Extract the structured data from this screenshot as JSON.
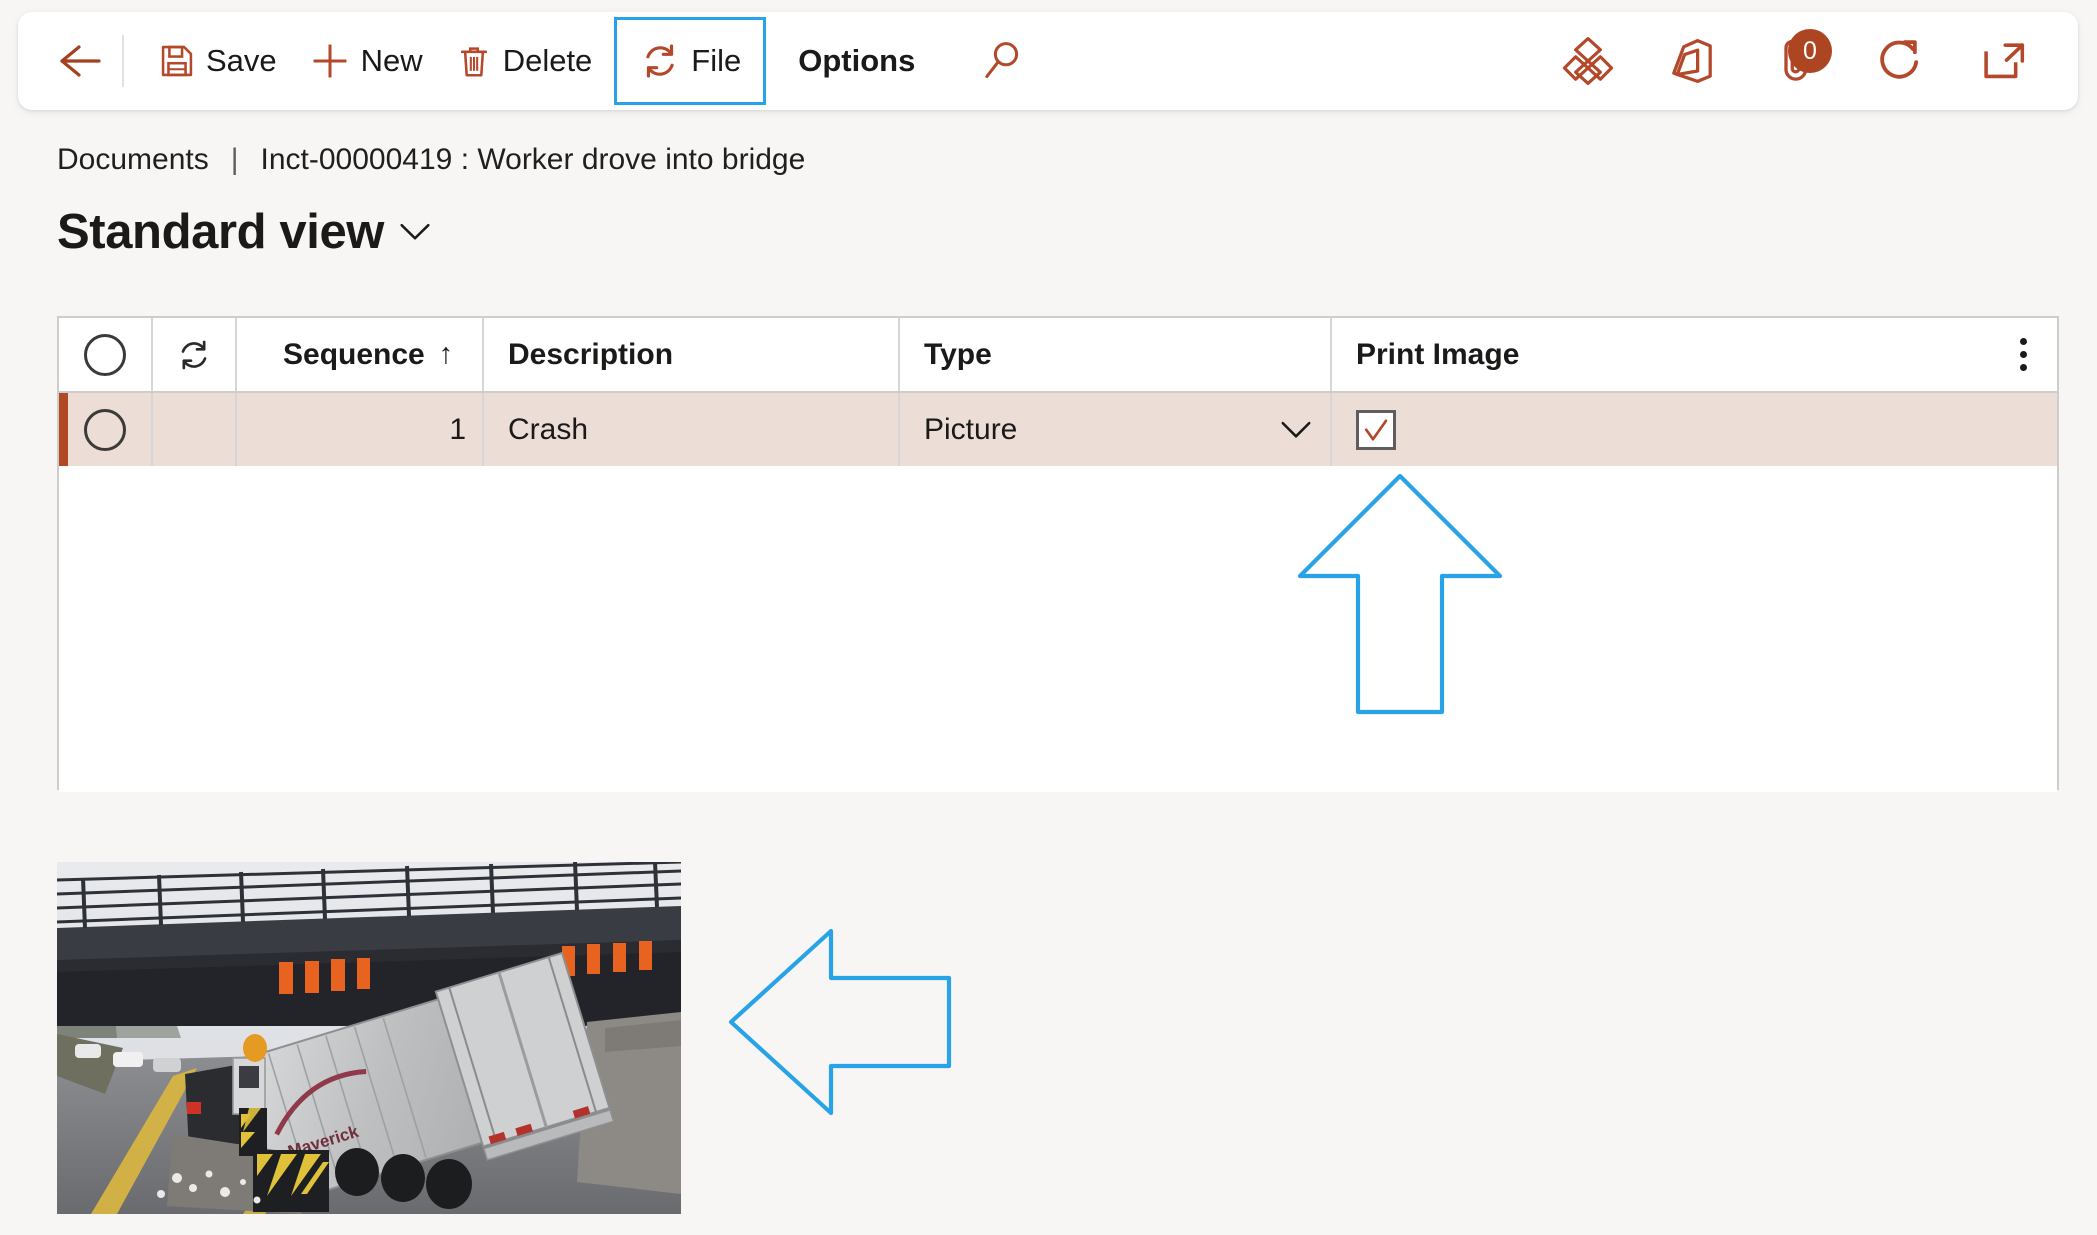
{
  "colors": {
    "accent": "#b04a24",
    "command_icon": "#b4482a",
    "annotation": "#29a3e8",
    "selected_row_bg": "#ecddd7",
    "page_bg": "#f7f6f4",
    "badge_bg": "#ae4522"
  },
  "commandbar": {
    "back": {
      "name": "back",
      "icon": "back-arrow-icon"
    },
    "items": [
      {
        "label": "Save",
        "icon": "save-floppy-icon",
        "bold": false,
        "highlighted": false
      },
      {
        "label": "New",
        "icon": "plus-icon",
        "bold": false,
        "highlighted": false
      },
      {
        "label": "Delete",
        "icon": "trash-icon",
        "bold": false,
        "highlighted": false
      },
      {
        "label": "File",
        "icon": "refresh-cycle-icon",
        "bold": false,
        "highlighted": true
      },
      {
        "label": "Options",
        "icon": "",
        "bold": true,
        "highlighted": false
      }
    ],
    "search": {
      "icon": "search-icon"
    },
    "right_icons": [
      {
        "name": "power-bi-diamond-icon",
        "badge": null
      },
      {
        "name": "office-app-icon",
        "badge": null
      },
      {
        "name": "attachment-clip-icon",
        "badge": "0"
      },
      {
        "name": "refresh-icon",
        "badge": null
      },
      {
        "name": "open-in-new-window-icon",
        "badge": null
      }
    ]
  },
  "breadcrumb": {
    "parent": "Documents",
    "separator": "|",
    "current": "Inct-00000419 : Worker drove into bridge"
  },
  "page": {
    "title": "Standard view",
    "title_chevron": "chevron-down-icon"
  },
  "grid": {
    "columns": [
      {
        "key": "select",
        "label": "",
        "type": "radio"
      },
      {
        "key": "refresh",
        "label": "",
        "type": "icon"
      },
      {
        "key": "sequence",
        "label": "Sequence",
        "type": "number",
        "sorted": true,
        "sort_dir": "ascending",
        "sort_glyph": "↑"
      },
      {
        "key": "description",
        "label": "Description",
        "type": "text"
      },
      {
        "key": "type",
        "label": "Type",
        "type": "dropdown"
      },
      {
        "key": "print_image",
        "label": "Print Image",
        "type": "checkbox"
      }
    ],
    "rows": [
      {
        "selected": true,
        "sequence": "1",
        "description": "Crash",
        "type": "Picture",
        "print_image": true,
        "print_image_glyph": "✓"
      }
    ],
    "header_menu": "column-options-kebab-icon"
  },
  "annotations": [
    {
      "name": "arrow-up-annotation",
      "direction": "up",
      "points_to": "print-image-checkbox"
    },
    {
      "name": "arrow-left-annotation",
      "direction": "left",
      "points_to": "attachment-preview-image"
    }
  ],
  "preview": {
    "alt": "Photo of semi-trailer truck wedged under a railway bridge overpass"
  }
}
